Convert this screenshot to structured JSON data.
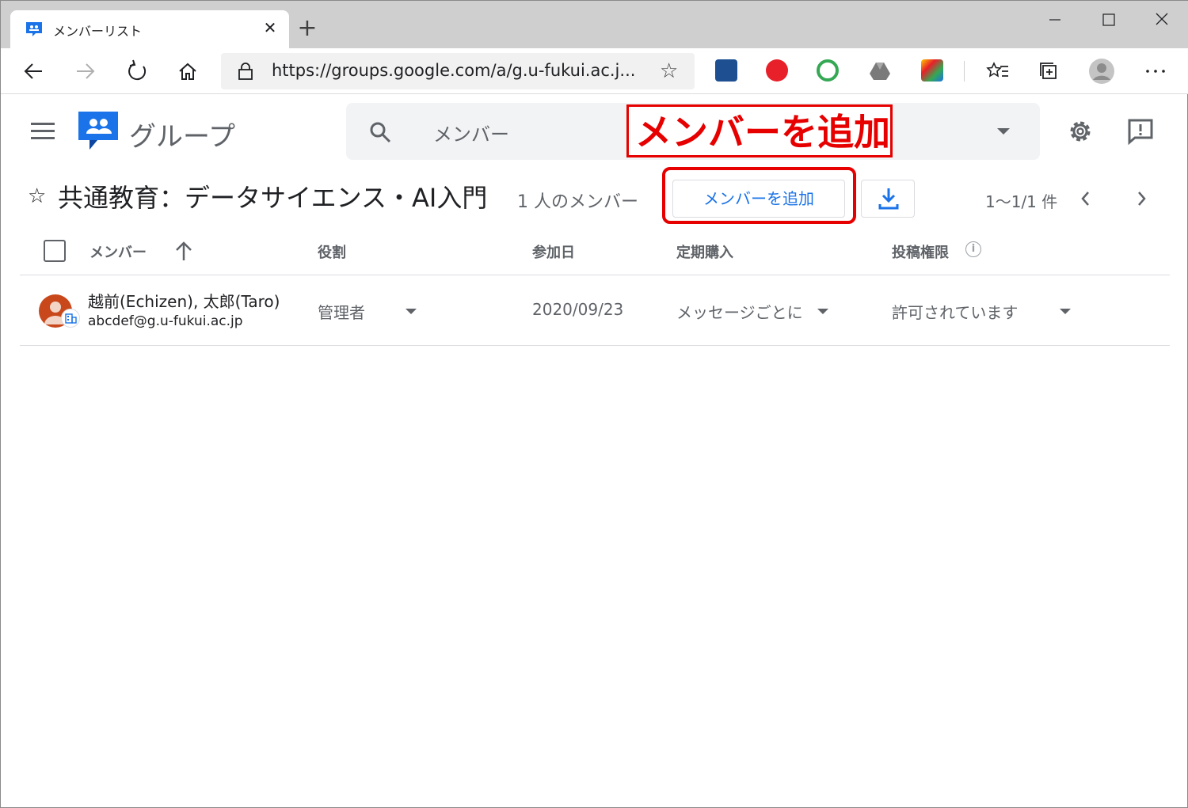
{
  "browser": {
    "tab_title": "メンバーリスト",
    "tab_close": "✕",
    "new_tab": "+",
    "url": "https://groups.google.com/a/g.u-fukui.ac.j...",
    "window": {
      "minimize": "—",
      "maximize": "☐",
      "close": "✕"
    }
  },
  "app": {
    "name": "グループ",
    "search_text": "メンバー"
  },
  "annotation": {
    "label": "メンバーを追加",
    "color": "#e60000"
  },
  "group": {
    "title": "共通教育：データサイエンス・AI入門",
    "member_count": "1 人のメンバー",
    "add_member_button": "メンバーを追加",
    "pager": "1〜1/1 件"
  },
  "table": {
    "columns": {
      "member": "メンバー",
      "role": "役割",
      "joined": "参加日",
      "subscription": "定期購入",
      "posting": "投稿権限"
    },
    "rows": [
      {
        "name": "越前(Echizen), 太郎(Taro)",
        "email": "abcdef@g.u-fukui.ac.jp",
        "role": "管理者",
        "joined": "2020/09/23",
        "subscription": "メッセージごとに",
        "posting": "許可されています"
      }
    ]
  },
  "colors": {
    "accent": "#1a73e8",
    "avatar": "#c9481b",
    "highlight": "#e60000"
  }
}
